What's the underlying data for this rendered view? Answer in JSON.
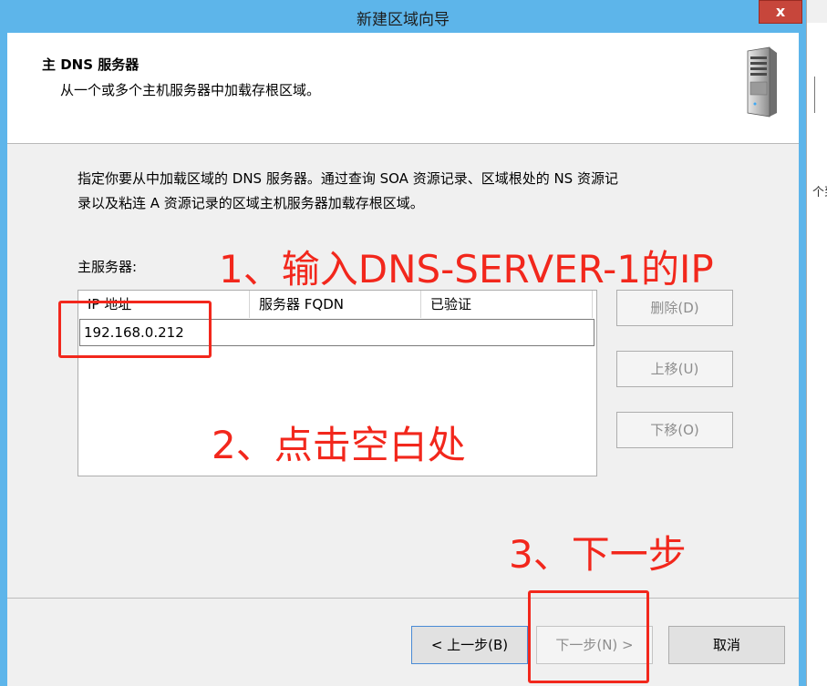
{
  "window": {
    "title": "新建区域向导",
    "close_label": "x"
  },
  "header": {
    "title": "主 DNS 服务器",
    "subtitle": "从一个或多个主机服务器中加载存根区域。"
  },
  "description": {
    "line1": "指定你要从中加载区域的 DNS 服务器。通过查询 SOA 资源记录、区域根处的 NS 资源记",
    "line2": "录以及粘连 A 资源记录的区域主机服务器加载存根区域。"
  },
  "primary_servers": {
    "label": "主服务器:",
    "columns": [
      "IP 地址",
      "服务器 FQDN",
      "已验证"
    ],
    "ip_value": "192.168.0.212"
  },
  "side_buttons": {
    "delete": "删除(D)",
    "move_up": "上移(U)",
    "move_down": "下移(O)"
  },
  "footer": {
    "back": "< 上一步(B)",
    "next": "下一步(N) >",
    "cancel": "取消"
  },
  "annotations": {
    "step1": "1、输入DNS-SERVER-1的IP",
    "step2": "2、点击空白处",
    "step3": "3、下一步"
  },
  "background_window": {
    "text": "个到"
  },
  "colors": {
    "title_bar": "#5db5ea",
    "close_button": "#c7463b",
    "annotation": "#f2271c",
    "dialog_body": "#f0f0f0"
  },
  "icons": {
    "server": "server-tower-icon"
  }
}
